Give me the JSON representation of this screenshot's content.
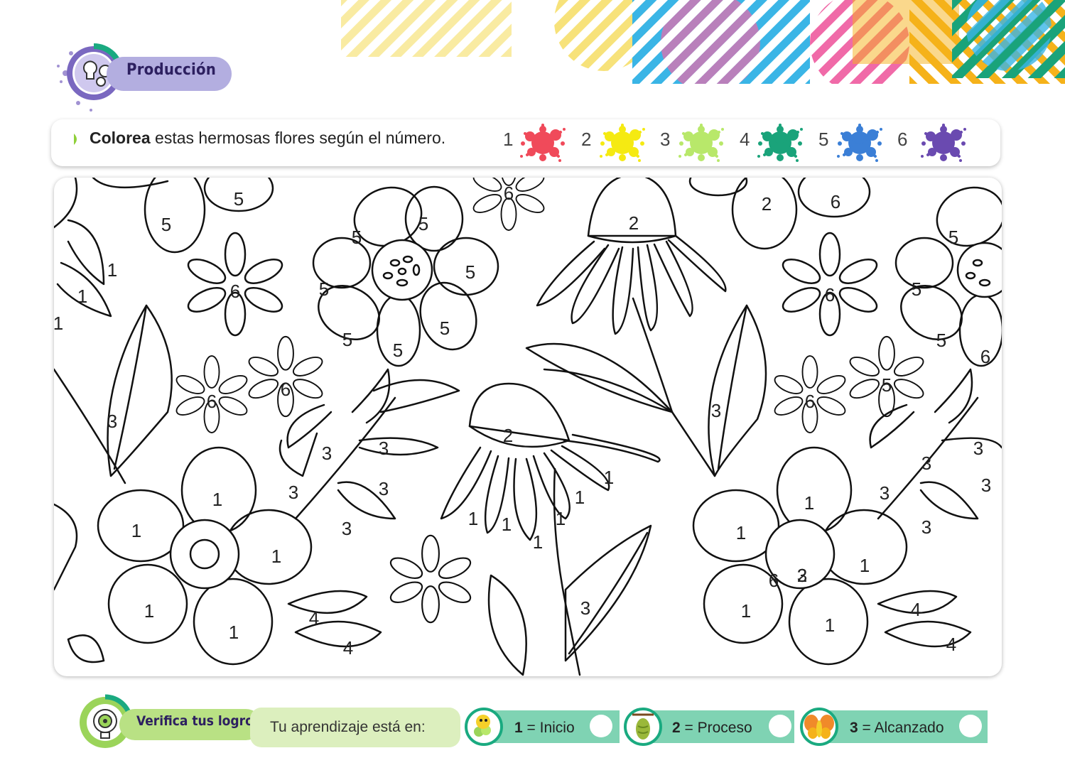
{
  "header": {
    "section_label": "Producción",
    "section_icon": "lightbulb-gears-icon",
    "badge_color": "#b3aee0"
  },
  "instruction": {
    "bold": "Colorea",
    "rest": " estas hermosas flores según el número.",
    "key": [
      {
        "num": "1",
        "color": "#f04a5a"
      },
      {
        "num": "2",
        "color": "#f5ea12"
      },
      {
        "num": "3",
        "color": "#b8e86a"
      },
      {
        "num": "4",
        "color": "#1aa37a"
      },
      {
        "num": "5",
        "color": "#3b7fd6"
      },
      {
        "num": "6",
        "color": "#6a4ab0"
      }
    ]
  },
  "coloring": {
    "numbers": [
      "5",
      "5",
      "1",
      "1",
      "1",
      "6",
      "5",
      "5",
      "5",
      "5",
      "5",
      "5",
      "5",
      "6",
      "6",
      "6",
      "3",
      "1",
      "1",
      "1",
      "1",
      "1",
      "3",
      "3",
      "3",
      "3",
      "3",
      "4",
      "4",
      "2",
      "2",
      "1",
      "1",
      "1",
      "1",
      "1",
      "1",
      "3",
      "3",
      "2",
      "6",
      "6",
      "6",
      "5",
      "5",
      "5",
      "5",
      "6",
      "6",
      "3",
      "1",
      "1",
      "2",
      "1",
      "1",
      "1",
      "3",
      "3",
      "3",
      "3",
      "3",
      "4",
      "4"
    ]
  },
  "footer": {
    "verify_label": "Verifica tus logros",
    "verify_icon": "target-lightbulb-icon",
    "learning_prompt": "Tu aprendizaje está en:",
    "levels": [
      {
        "num": "1",
        "label": " = Inicio",
        "icon": "caterpillar-icon"
      },
      {
        "num": "2",
        "label": " = Proceso",
        "icon": "cocoon-icon"
      },
      {
        "num": "3",
        "label": " = Alcanzado",
        "icon": "butterfly-icon"
      }
    ]
  }
}
